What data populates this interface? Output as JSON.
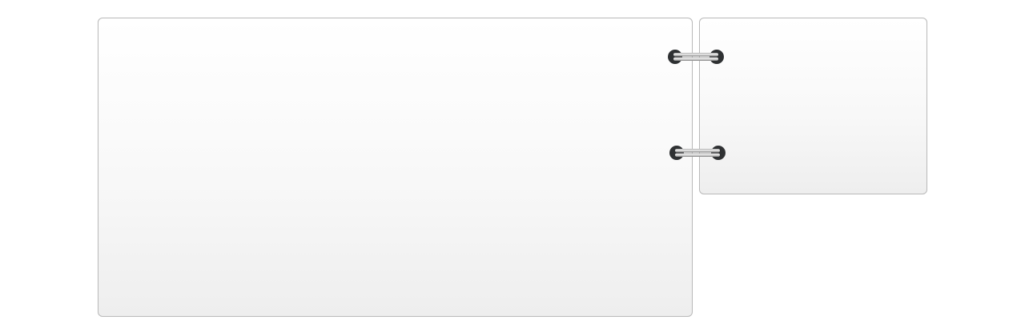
{
  "panels": {
    "main": {
      "label": ""
    },
    "side": {
      "label": ""
    }
  },
  "binder": {
    "rings": [
      {
        "icon": "binder-ring-icon"
      },
      {
        "icon": "binder-ring-icon"
      }
    ]
  },
  "colors": {
    "panel_border": "#b9b9b9",
    "panel_top": "#ffffff",
    "panel_bottom": "#eeeeee",
    "ring_hole": "#2f3133",
    "ring_metal_light": "#f2f2f2",
    "ring_metal_dark": "#8a8a8a"
  }
}
